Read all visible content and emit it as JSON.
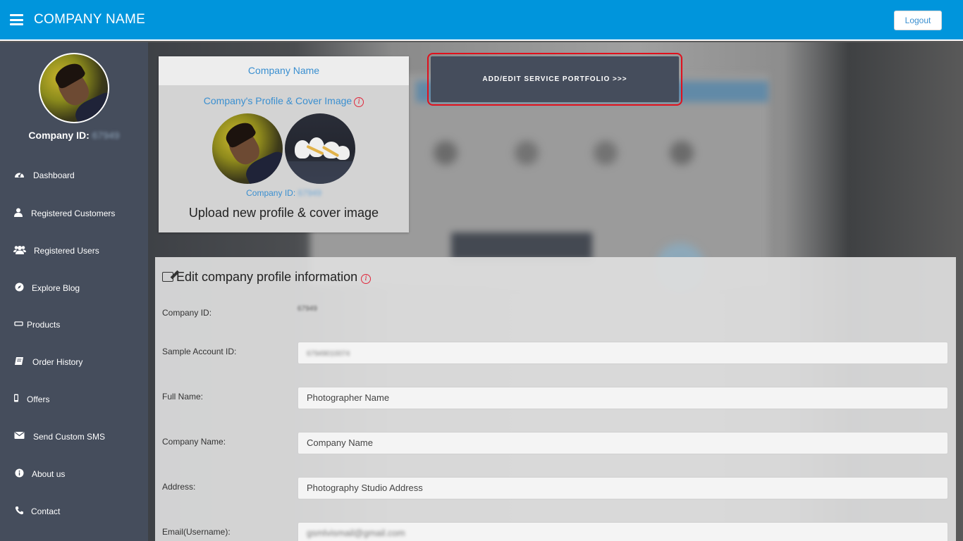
{
  "header": {
    "app_title": "COMPANY NAME",
    "logout_label": "Logout"
  },
  "sidebar": {
    "company_id_label": "Company ID:",
    "company_id_value": "67949",
    "items": [
      {
        "label": "Dashboard",
        "icon": "dashboard-icon"
      },
      {
        "label": "Registered Customers",
        "icon": "user-icon"
      },
      {
        "label": "Registered Users",
        "icon": "users-icon"
      },
      {
        "label": "Explore Blog",
        "icon": "compass-icon"
      },
      {
        "label": "Products",
        "icon": "product-icon"
      },
      {
        "label": "Order History",
        "icon": "book-icon"
      },
      {
        "label": "Offers",
        "icon": "mobile-icon"
      },
      {
        "label": "Send Custom SMS",
        "icon": "envelope-icon"
      },
      {
        "label": "About us",
        "icon": "info-icon"
      },
      {
        "label": "Contact",
        "icon": "phone-icon"
      }
    ]
  },
  "profile_card": {
    "title": "Company Name",
    "cover_label": "Company's Profile & Cover Image",
    "company_id_label": "Company ID:",
    "company_id_value": "67949",
    "upload_link": "Upload new profile & cover image"
  },
  "portfolio_button": {
    "label": "ADD/EDIT SERVICE PORTFOLIO >>>"
  },
  "form": {
    "title": "Edit company profile information",
    "fields": {
      "company_id": {
        "label": "Company ID:",
        "value": "67949"
      },
      "sample_account_id": {
        "label": "Sample Account ID:",
        "value": "67949010074"
      },
      "full_name": {
        "label": "Full Name:",
        "value": "Photographer Name"
      },
      "company_name": {
        "label": "Company Name:",
        "value": "Company Name"
      },
      "address": {
        "label": "Address:",
        "value": "Photography Studio Address"
      },
      "email": {
        "label": "Email(Username):",
        "value": "gsmlvismail@gmail.com"
      }
    }
  },
  "colors": {
    "topbar": "#0095dc",
    "sidebar": "#454d5c",
    "accent_link": "#3a8fd0",
    "highlight_border": "#e0101c"
  }
}
